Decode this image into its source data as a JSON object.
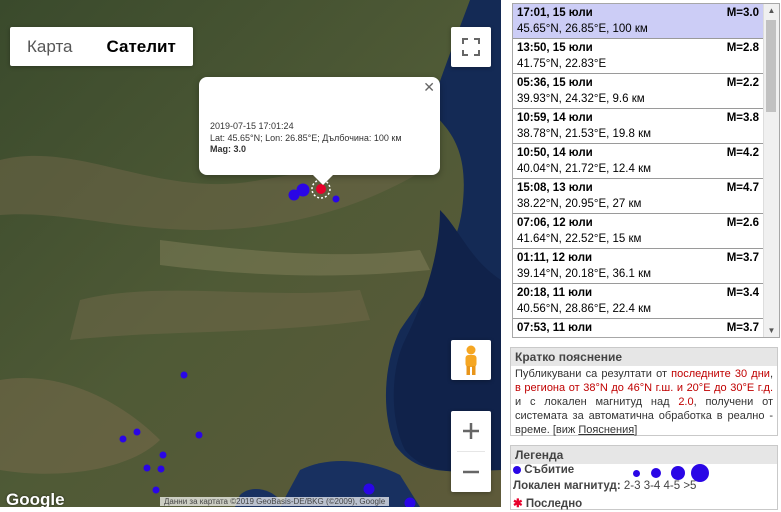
{
  "map": {
    "type_buttons": [
      "Карта",
      "Сателит"
    ],
    "google_logo": "Google",
    "attribution": "Данни за картата ©2019 GeoBasis-DE/BKG (©2009), Google",
    "info_window": {
      "title": "2019-07-15 17:01:24",
      "details": "Lat: 45.65°N; Lon: 26.85°E; Дълбочина: 100 км",
      "magnitude": "Mag: 3.0",
      "close": "✕"
    }
  },
  "events": [
    {
      "time": "17:01, 15 юли",
      "mag": "M=3.0",
      "loc": "45.65°N, 26.85°E, 100 км",
      "active": true
    },
    {
      "time": "13:50, 15 юли",
      "mag": "M=2.8",
      "loc": "41.75°N, 22.83°E"
    },
    {
      "time": "05:36, 15 юли",
      "mag": "M=2.2",
      "loc": "39.93°N, 24.32°E, 9.6 км"
    },
    {
      "time": "10:59, 14 юли",
      "mag": "M=3.8",
      "loc": "38.78°N, 21.53°E, 19.8 км"
    },
    {
      "time": "10:50, 14 юли",
      "mag": "M=4.2",
      "loc": "40.04°N, 21.72°E, 12.4 км"
    },
    {
      "time": "15:08, 13 юли",
      "mag": "M=4.7",
      "loc": "38.22°N, 20.95°E, 27 км"
    },
    {
      "time": "07:06, 12 юли",
      "mag": "M=2.6",
      "loc": "41.64°N, 22.52°E, 15 км"
    },
    {
      "time": "01:11, 12 юли",
      "mag": "M=3.7",
      "loc": "39.14°N, 20.18°E, 36.1 км"
    },
    {
      "time": "20:18, 11 юли",
      "mag": "M=3.4",
      "loc": "40.56°N, 28.86°E, 22.4 км"
    },
    {
      "time": "07:53, 11 юли",
      "mag": "M=3.7",
      "loc": ""
    }
  ],
  "explanation": {
    "heading": "Кратко пояснение",
    "t1": "Публикувани са резултати от ",
    "r1": "последните 30 дни",
    "t2": ", ",
    "r2": "в региона от 38°N до 46°N г.ш. и 20°E до 30°E г.д.",
    "t3": " и с локален магнитуд над ",
    "r3": "2.0",
    "t4": ", получени от системата за автоматична обработка в реално - време. [виж ",
    "link": "Пояснения",
    "t5": "]"
  },
  "legend": {
    "heading": "Легенда",
    "event_label": "Събитие",
    "magnitude_label": "Локален магнитуд:",
    "classes": [
      "2-3",
      "3-4",
      "4-5",
      ">5"
    ],
    "latest_label": "Последно"
  },
  "colors": {
    "event": "#2a06e6",
    "latest": "#e8002b",
    "active_row": "#cccdf6"
  }
}
